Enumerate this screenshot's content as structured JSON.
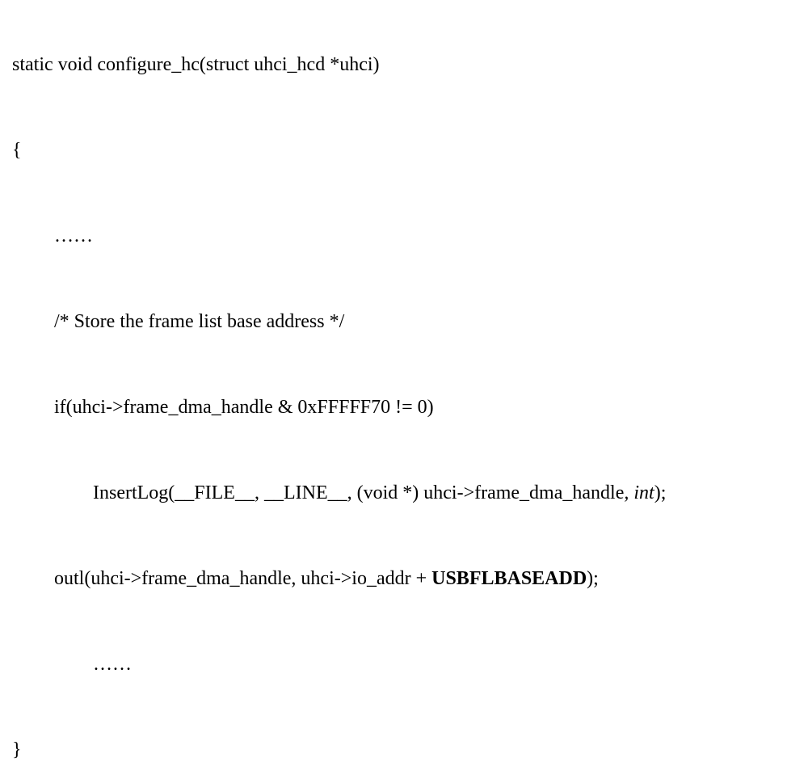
{
  "code": {
    "line1": "static void configure_hc(struct uhci_hcd *uhci)",
    "line2": "{",
    "line3": "……",
    "line4": "/* Store the frame list base address */",
    "line5": "if(uhci->frame_dma_handle & 0xFFFFF70 != 0)",
    "line6_part1": "InsertLog(__FILE__, __LINE__, (void *) uhci->frame_dma_handle",
    "line6_italic": ", int",
    "line6_part2": ");",
    "line7_part1": "outl(uhci->frame_dma_handle, uhci->io_addr + ",
    "line7_bold": "USBFLBASEADD",
    "line7_part2": ");",
    "line8": "……",
    "line9": "}"
  }
}
